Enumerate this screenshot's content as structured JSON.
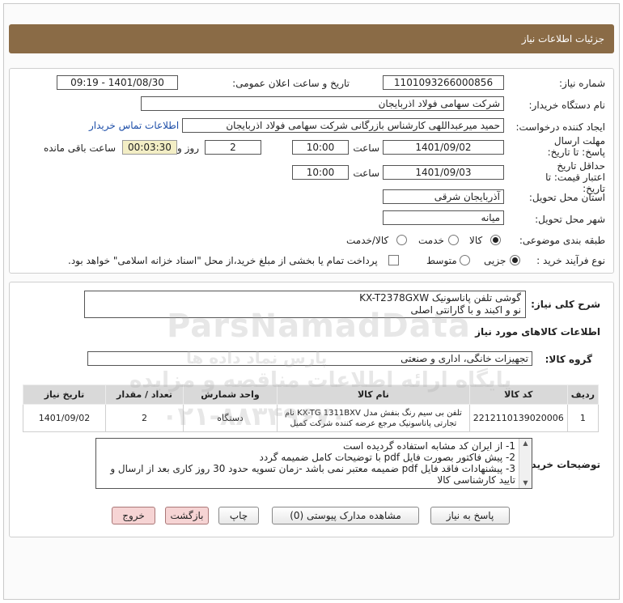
{
  "header": {
    "title": "جزئیات اطلاعات نیاز"
  },
  "form": {
    "need_number_label": "شماره نیاز:",
    "need_number": "1101093266000856",
    "announce_label": "تاریخ و ساعت اعلان عمومی:",
    "announce_value": "1401/08/30 - 09:19",
    "buyer_org_label": "نام دستگاه خریدار:",
    "buyer_org": "شرکت سهامی فولاد اذربایجان",
    "creator_label": "ایجاد کننده درخواست:",
    "creator": "حمید میرعبداللهی کارشناس بازرگانی شرکت سهامی فولاد اذربایجان",
    "contact_link": "اطلاعات تماس خریدار",
    "deadline_label": "مهلت ارسال پاسخ: تا تاریخ:",
    "deadline_date": "1401/09/02",
    "time_label": "ساعت",
    "deadline_time": "10:00",
    "days_value": "2",
    "days_label": "روز و",
    "remaining_time": "00:03:30",
    "remaining_label": "ساعت باقی مانده",
    "validity_label": "حداقل تاریخ اعتبار قیمت: تا تاریخ:",
    "validity_date": "1401/09/03",
    "validity_time_label": "ساعت",
    "validity_time": "10:00",
    "province_label": "استان محل تحویل:",
    "province": "آذربایجان شرقی",
    "city_label": "شهر محل تحویل:",
    "city": "میانه",
    "category_label": "طبقه بندی موضوعی:",
    "category_options": [
      "کالا",
      "خدمت",
      "کالا/خدمت"
    ],
    "process_label": "نوع فرآیند خرید :",
    "process_options": [
      "جزیی",
      "متوسط"
    ],
    "payment_note": "پرداخت تمام یا بخشی از مبلغ خرید،از محل \"اسناد خزانه اسلامی\" خواهد بود."
  },
  "details": {
    "summary_label": "شرح کلی نیاز:",
    "summary_line1": "گوشی تلفن پاناسونیک KX-T2378GXW",
    "summary_line2": "نو و اکبند و با گارانتی اصلی",
    "goods_info_title": "اطلاعات کالاهای مورد نیاز",
    "group_label": "گروه کالا:",
    "group_value": "تجهیزات خانگی، اداری و صنعتی",
    "table": {
      "headers": [
        "ردیف",
        "کد کالا",
        "نام کالا",
        "واحد شمارش",
        "تعداد / مقدار",
        "تاریخ نیاز"
      ],
      "rows": [
        [
          "1",
          "2212110139020006",
          "تلفن بی سیم رنگ بنفش مدل KX-TG 1311BXV نام تجارتی پاناسونیک مرجع عرضه کننده شرکت کمیل",
          "دستگاه",
          "2",
          "1401/09/02"
        ]
      ]
    },
    "notes_label": "توضیحات خریدار:",
    "notes": [
      "1- از ایران کد مشابه استفاده گردیده است",
      "2- پیش فاکتور بصورت فایل pdf با توضیحات کامل ضمیمه گردد",
      "3- پیشنهادات فاقد فایل pdf  ضمیمه معتبر نمی باشد -زمان تسویه حدود 30 روز کاری بعد از ارسال و تایید کارشناسی کالا"
    ]
  },
  "buttons": {
    "reply": "پاسخ به نیاز",
    "attachments": "مشاهده مدارک پیوستی (0)",
    "print": "چاپ",
    "back": "بازگشت",
    "exit": "خروج"
  },
  "watermark": {
    "brand": "ParsNamadData",
    "persian": "پارس نماد داده ها",
    "slogan": "پایگاه ارائه اطلاعات مناقصه و مزایده",
    "phone": "۰۲۱-۸۸۳۴۹۶۷۰"
  },
  "colors": {
    "header_bg": "#8a6b46",
    "link": "#1d4ea8",
    "countdown_bg": "#f3eec5"
  }
}
